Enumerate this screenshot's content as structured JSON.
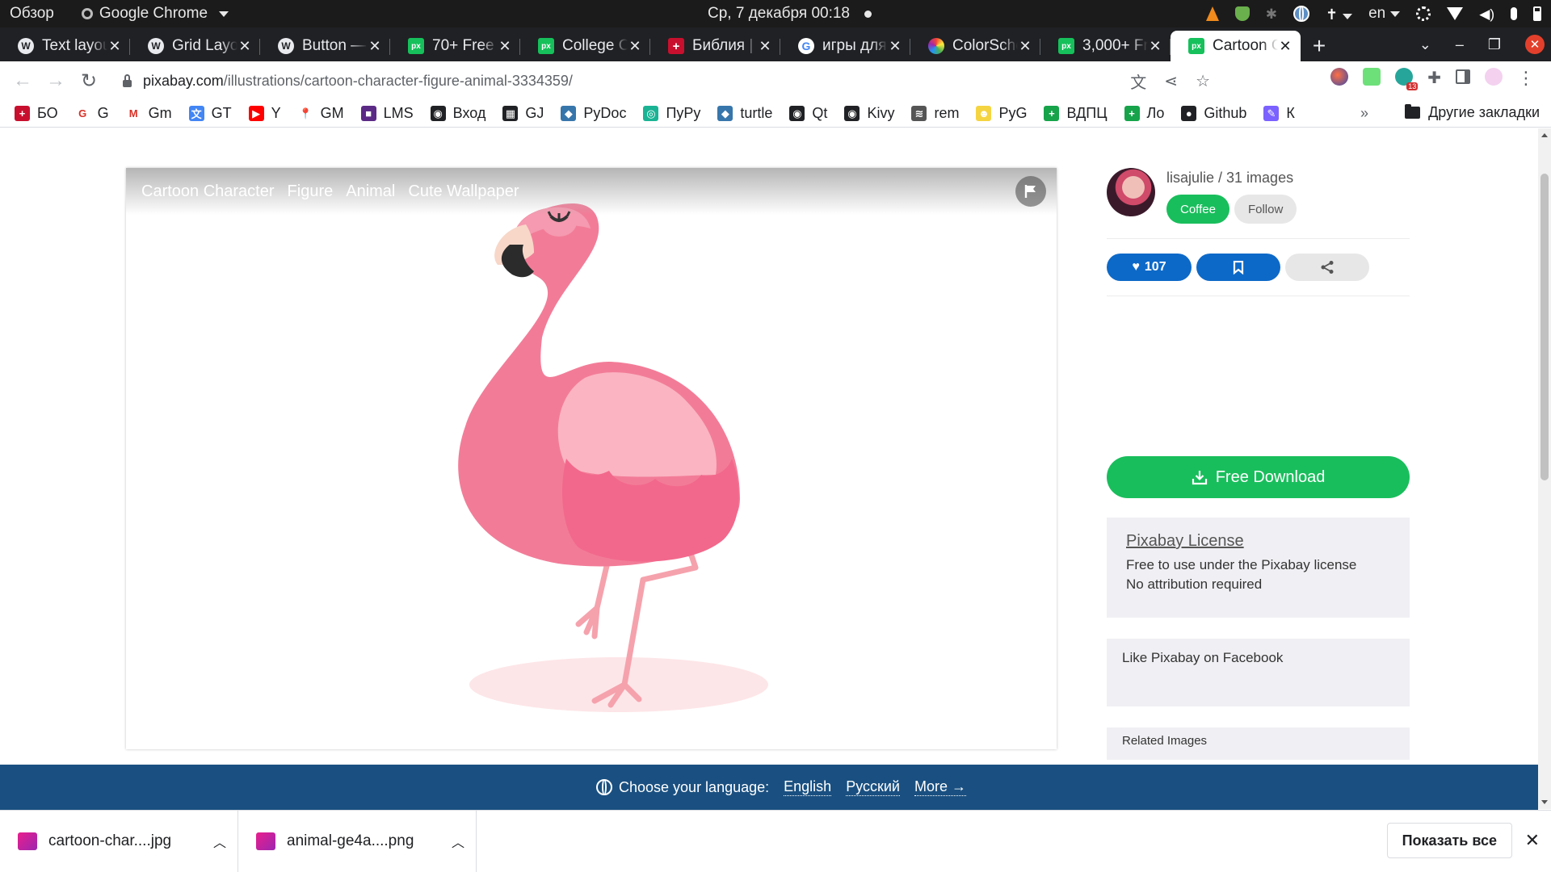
{
  "os": {
    "overview": "Обзор",
    "app": "Google Chrome",
    "datetime": "Ср, 7 декабря  00:18",
    "lang": "en"
  },
  "tabs": [
    {
      "title": "Text layout",
      "favicon": "wp"
    },
    {
      "title": "Grid Layout",
      "favicon": "wp"
    },
    {
      "title": "Button — ",
      "favicon": "wp"
    },
    {
      "title": "70+ Free",
      "favicon": "px"
    },
    {
      "title": "College C",
      "favicon": "px"
    },
    {
      "title": "Библия |",
      "favicon": "bible"
    },
    {
      "title": "игры для",
      "favicon": "google"
    },
    {
      "title": "ColorSche",
      "favicon": "color"
    },
    {
      "title": "3,000+ Fr",
      "favicon": "px"
    },
    {
      "title": "Cartoon C",
      "favicon": "px",
      "active": true
    }
  ],
  "address": {
    "host": "pixabay.com",
    "path": "/illustrations/cartoon-character-figure-animal-3334359/"
  },
  "bookmarks": [
    {
      "label": "БО",
      "color": "#c8102e",
      "glyph": "+"
    },
    {
      "label": "G",
      "color": "#ffffff",
      "glyph": "G"
    },
    {
      "label": "Gm",
      "color": "#ffffff",
      "glyph": "M"
    },
    {
      "label": "GT",
      "color": "#4285f4",
      "glyph": "文"
    },
    {
      "label": "Y",
      "color": "#ff0000",
      "glyph": "▶"
    },
    {
      "label": "GM",
      "color": "#ffffff",
      "glyph": "📍"
    },
    {
      "label": "LMS",
      "color": "#5b2a86",
      "glyph": "■"
    },
    {
      "label": "Вход",
      "color": "#202124",
      "glyph": "◉"
    },
    {
      "label": "GJ",
      "color": "#202124",
      "glyph": "▦"
    },
    {
      "label": "PyDoc",
      "color": "#3776ab",
      "glyph": "◆"
    },
    {
      "label": "ПуРу",
      "color": "#1ab394",
      "glyph": "◎"
    },
    {
      "label": "turtle",
      "color": "#3776ab",
      "glyph": "◆"
    },
    {
      "label": "Qt",
      "color": "#202124",
      "glyph": "◉"
    },
    {
      "label": "Kivy",
      "color": "#202124",
      "glyph": "◉"
    },
    {
      "label": "rem",
      "color": "#555555",
      "glyph": "≋"
    },
    {
      "label": "PyG",
      "color": "#f5d442",
      "glyph": "☻"
    },
    {
      "label": "ВДПЦ",
      "color": "#16a34a",
      "glyph": "+"
    },
    {
      "label": "Ло",
      "color": "#16a34a",
      "glyph": "+"
    },
    {
      "label": "Github",
      "color": "#202124",
      "glyph": "●"
    },
    {
      "label": "К",
      "color": "#7b61ff",
      "glyph": "✎"
    }
  ],
  "bookmarks_more": "»",
  "bookmarks_other": "Другие закладки",
  "image": {
    "tags": [
      "Cartoon Character",
      "Figure",
      "Animal",
      "Cute Wallpaper"
    ]
  },
  "author": {
    "name": "lisajulie / 31 images",
    "coffee": "Coffee",
    "follow": "Follow"
  },
  "actions": {
    "likes": "107"
  },
  "download": {
    "label": "Free Download"
  },
  "license": {
    "title": "Pixabay License",
    "line1": "Free to use under the Pixabay license",
    "line2": "No attribution required"
  },
  "facebook": "Like Pixabay on Facebook",
  "related": "Related Images",
  "language_bar": {
    "prompt": "Choose your language:",
    "english": "English",
    "russian": "Русский",
    "more": "More →"
  },
  "downloads": [
    {
      "name": "cartoon-char....jpg"
    },
    {
      "name": "animal-ge4a....png"
    }
  ],
  "show_all": "Показать все"
}
